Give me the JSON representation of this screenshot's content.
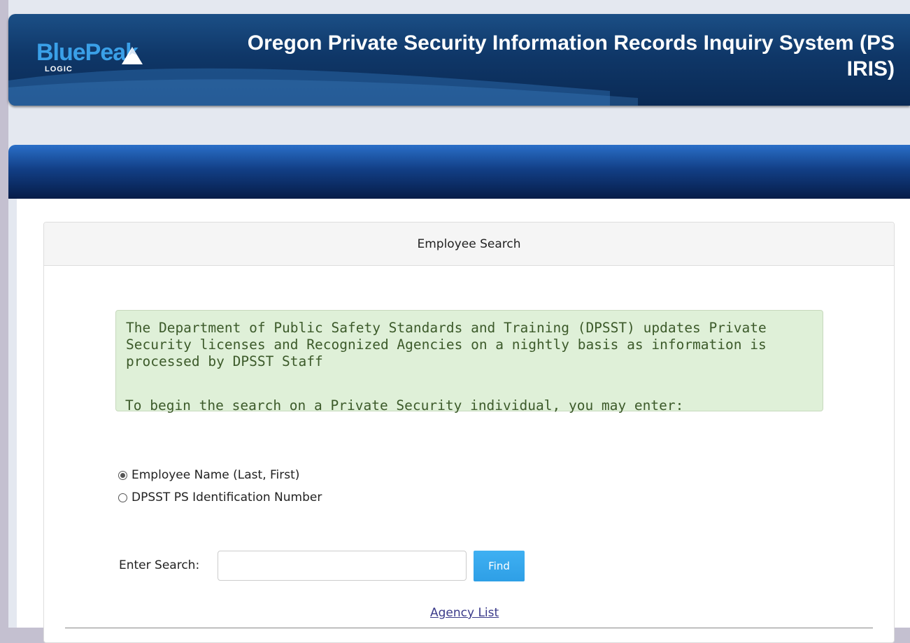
{
  "header": {
    "logo_text": "BluePeak",
    "logo_sub": "LOGIC",
    "title": "Oregon Private Security Information Records Inquiry System (PS IRIS)"
  },
  "panel": {
    "heading": "Employee Search"
  },
  "notice": {
    "paragraph_1": "The Department of Public Safety Standards and Training (DPSST) updates Private Security licenses and Recognized Agencies on a nightly basis as information is processed by DPSST Staff",
    "paragraph_2": "To begin the search on a Private Security individual, you may enter:"
  },
  "search": {
    "options": [
      {
        "label": "Employee Name (Last, First)",
        "selected": true
      },
      {
        "label": "DPSST PS Identification Number",
        "selected": false
      }
    ],
    "label": "Enter Search:",
    "value": "",
    "placeholder": "",
    "button_label": "Find"
  },
  "links": {
    "agency_list": "Agency List"
  },
  "colors": {
    "banner": "#0f3768",
    "logo_blue": "#3aa0e8",
    "notice_bg": "#dff0d8",
    "find_button": "#2e9fe6",
    "link": "#3b3b8a"
  },
  "icons": {
    "logo_mark": "mountain-peak-icon"
  }
}
